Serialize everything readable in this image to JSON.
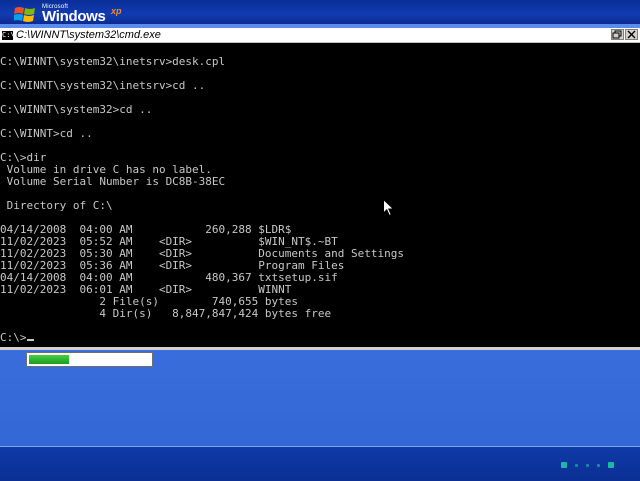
{
  "branding": {
    "microsoft": "Microsoft",
    "windows": "Windows",
    "xp": "xp"
  },
  "window": {
    "title": "C:\\WINNT\\system32\\cmd.exe",
    "title_icon": "C:\\"
  },
  "terminal": {
    "lines": [
      "",
      "C:\\WINNT\\system32\\inetsrv>desk.cpl",
      "",
      "C:\\WINNT\\system32\\inetsrv>cd ..",
      "",
      "C:\\WINNT\\system32>cd ..",
      "",
      "C:\\WINNT>cd ..",
      "",
      "C:\\>dir",
      " Volume in drive C has no label.",
      " Volume Serial Number is DC8B-38EC",
      "",
      " Directory of C:\\",
      "",
      "04/14/2008  04:00 AM           260,288 $LDR$",
      "11/02/2023  05:52 AM    <DIR>          $WIN_NT$.~BT",
      "11/02/2023  05:30 AM    <DIR>          Documents and Settings",
      "11/02/2023  05:36 AM    <DIR>          Program Files",
      "04/14/2008  04:00 AM           480,367 txtsetup.sif",
      "11/02/2023  06:01 AM    <DIR>          WINNT",
      "               2 File(s)        740,655 bytes",
      "               4 Dir(s)   8,847,847,424 bytes free",
      "",
      "C:\\>"
    ]
  },
  "progress": {
    "fraction": 0.33
  },
  "colors": {
    "banner": "#113bb3",
    "desktop": "#3d72df",
    "terminal_bg": "#000000",
    "terminal_fg": "#c8c8c8",
    "progress_fill": "#1b9c1b",
    "accent_dots": "#23c4a9"
  },
  "icons": {
    "window_icon": "cmd-icon",
    "restore": "restore-icon",
    "close": "close-icon",
    "pointer": "mouse-pointer-icon"
  }
}
